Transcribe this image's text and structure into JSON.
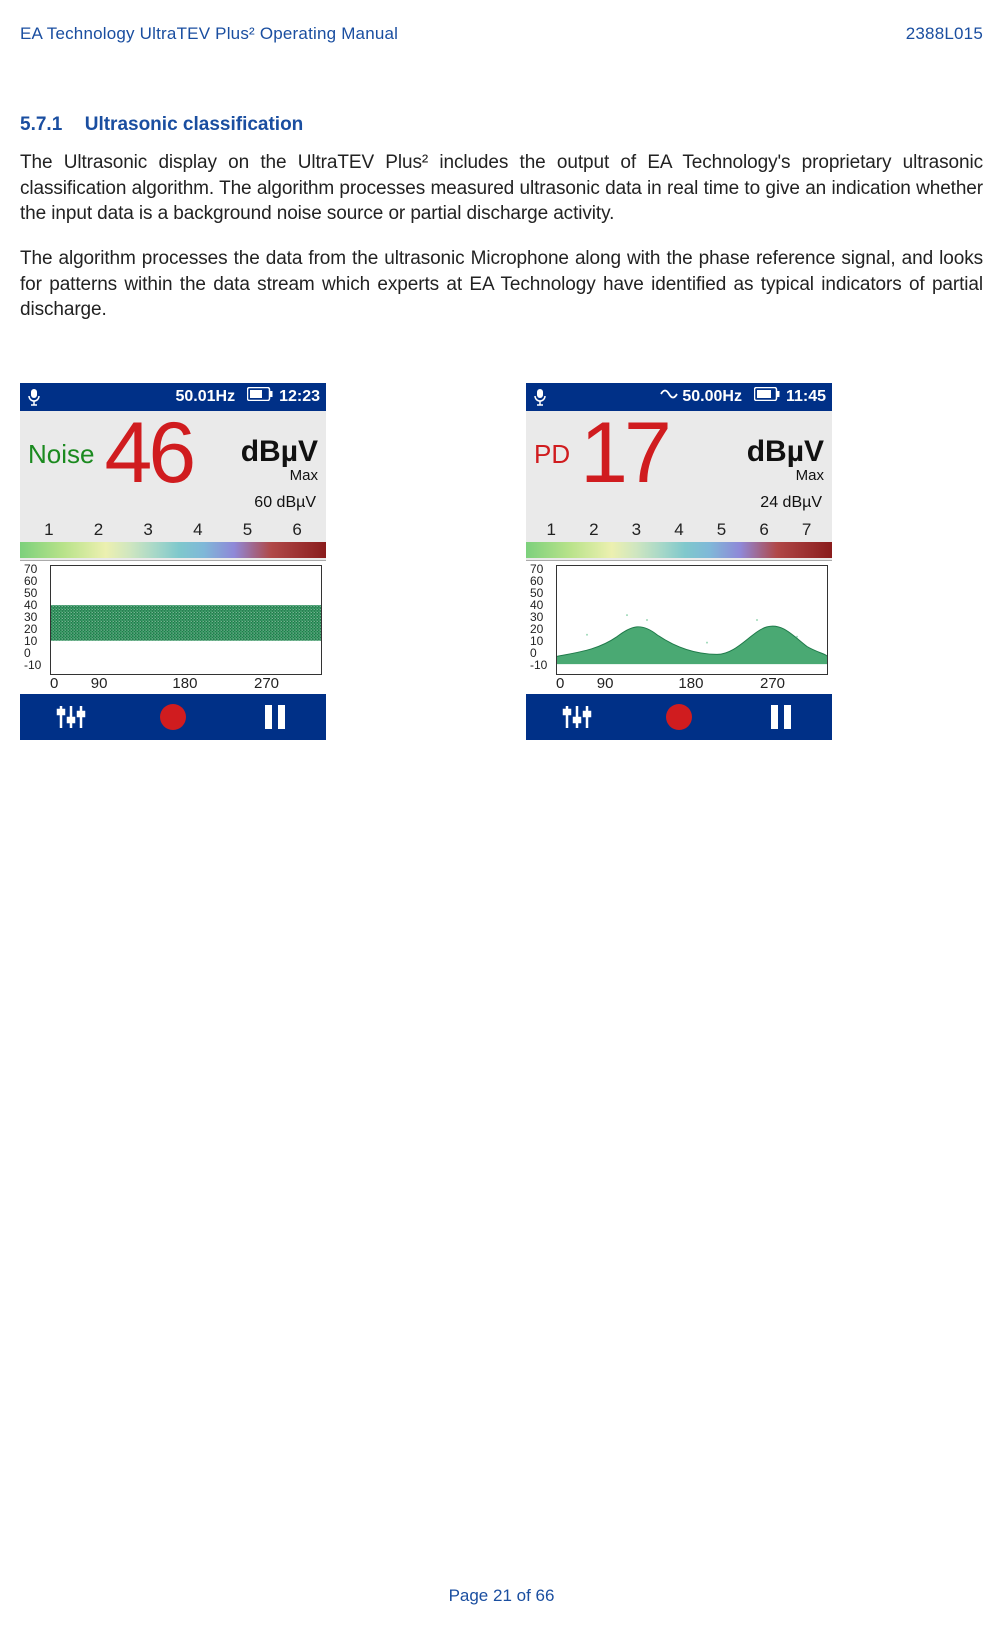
{
  "header": {
    "left": "EA Technology UltraTEV Plus² Operating Manual",
    "right": "2388L015"
  },
  "section": {
    "number": "5.7.1",
    "title": "Ultrasonic classification"
  },
  "paragraphs": {
    "p1": "The Ultrasonic display on the UltraTEV Plus² includes the output of EA Technology's proprietary ultrasonic classification algorithm. The algorithm processes measured ultrasonic data in real time to give an indication whether the input data is a background noise source or partial discharge activity.",
    "p2": "The algorithm processes the data from the ultrasonic Microphone along with the phase reference signal, and looks for patterns within the data stream which experts at EA Technology have identified as typical indicators of partial discharge."
  },
  "devices": {
    "left": {
      "hz": "50.01Hz",
      "time": "12:23",
      "class_label": "Noise",
      "value": "46",
      "units": "dBµV",
      "max_label": "Max",
      "max_line": "60  dBµV",
      "scale": [
        "1",
        "2",
        "3",
        "4",
        "5",
        "6"
      ],
      "ylabels": [
        "70",
        "60",
        "50",
        "40",
        "30",
        "20",
        "10",
        "0",
        "-10"
      ],
      "xlabels": [
        "0",
        "90",
        "180",
        "270"
      ]
    },
    "right": {
      "hz": "50.00Hz",
      "time": "11:45",
      "class_label": "PD",
      "value": "17",
      "units": "dBµV",
      "max_label": "Max",
      "max_line": "24 dBµV",
      "scale": [
        "1",
        "2",
        "3",
        "4",
        "5",
        "6",
        "7"
      ],
      "ylabels": [
        "70",
        "60",
        "50",
        "40",
        "30",
        "20",
        "10",
        "0",
        "-10"
      ],
      "xlabels": [
        "0",
        "90",
        "180",
        "270"
      ]
    }
  },
  "footer": "Page 21 of 66"
}
